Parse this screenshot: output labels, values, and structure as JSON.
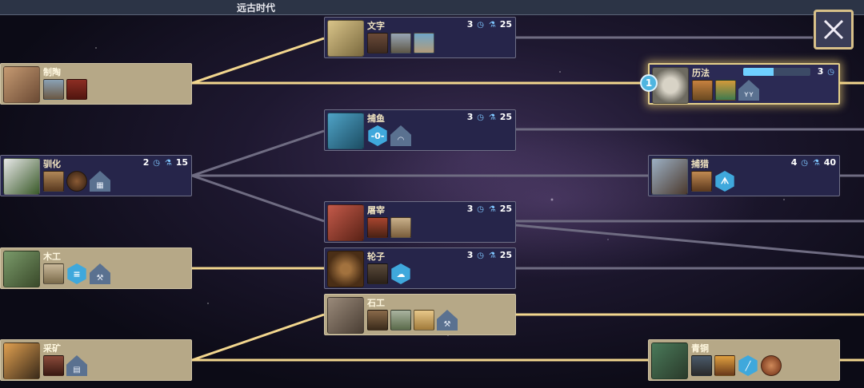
{
  "era": {
    "title": "远古时代"
  },
  "techs": {
    "pottery": {
      "name": "制陶",
      "icon": "pottery-icon"
    },
    "writing": {
      "name": "文字",
      "turns": "3",
      "science": "25",
      "icon": "tablet-icon"
    },
    "calendar": {
      "name": "历法",
      "turns": "3",
      "icon": "sundial-icon",
      "queue": "1",
      "progress": 0.45
    },
    "fishing": {
      "name": "捕鱼",
      "turns": "3",
      "science": "25",
      "icon": "fish-icon",
      "bonus": "-0-"
    },
    "domestication": {
      "name": "驯化",
      "turns": "2",
      "science": "15",
      "icon": "cow-icon"
    },
    "hunting": {
      "name": "捕猎",
      "turns": "4",
      "science": "40",
      "icon": "mammoth-icon"
    },
    "butchery": {
      "name": "屠宰",
      "turns": "3",
      "science": "25",
      "icon": "meat-icon"
    },
    "woodworking": {
      "name": "木工",
      "icon": "axe-icon"
    },
    "wheel": {
      "name": "轮子",
      "turns": "3",
      "science": "25",
      "icon": "wheel-icon"
    },
    "masonry": {
      "name": "石工",
      "icon": "stone-icon"
    },
    "mining": {
      "name": "采矿",
      "icon": "pickaxe-icon"
    },
    "bronze": {
      "name": "青铜",
      "icon": "anvil-icon"
    }
  },
  "glyphs": {
    "turns": "◷",
    "science": "⚗"
  },
  "colors": {
    "line_active": "#f2d68e",
    "line_inactive": "#6f6c82",
    "accent": "#e4cf8a"
  }
}
